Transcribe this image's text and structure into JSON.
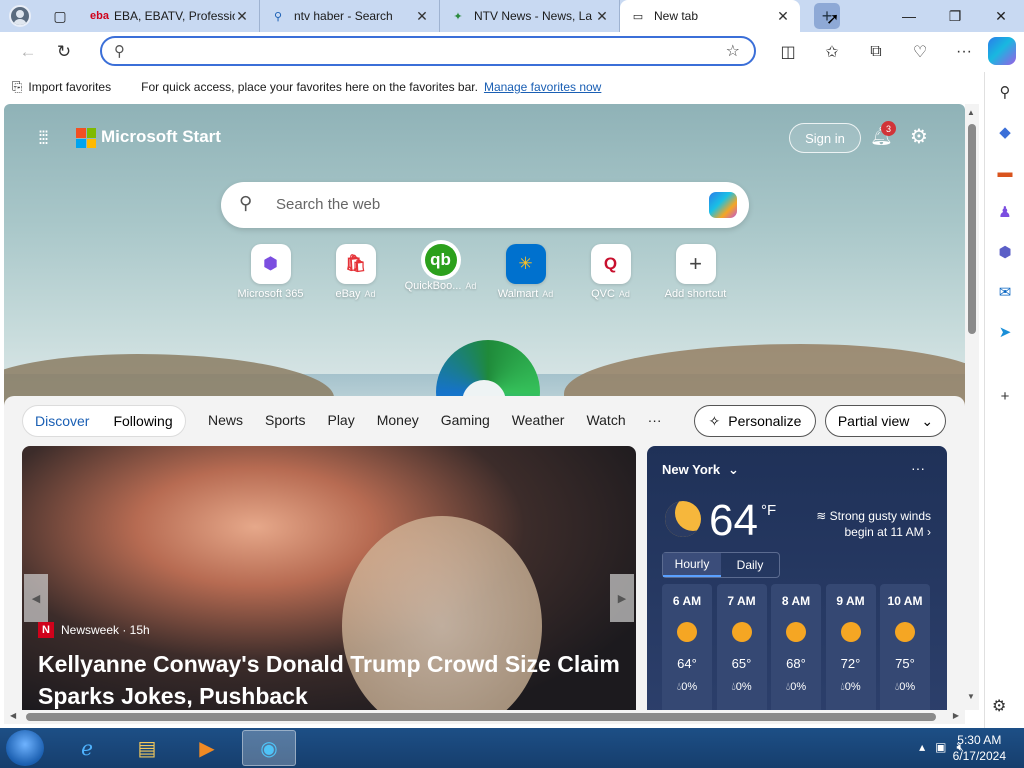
{
  "tabs": [
    {
      "favicon": "ebatv",
      "title": "EBA, EBATV, Professio",
      "color": "#d0021b"
    },
    {
      "favicon": "search-icon",
      "title": "ntv haber - Search",
      "color": "#1a5fb4"
    },
    {
      "favicon": "ntv",
      "title": "NTV News - News, La",
      "color": "#2b8a3e"
    },
    {
      "favicon": "newtab-icon",
      "title": "New tab",
      "color": "#333"
    }
  ],
  "favorites_bar": {
    "import_label": "Import favorites",
    "message": "For quick access, place your favorites here on the favorites bar.",
    "manage_link": "Manage favorites now"
  },
  "start": {
    "title": "Microsoft Start",
    "sign_in": "Sign in",
    "notif_count": "3",
    "search_placeholder": "Search the web"
  },
  "shortcuts": [
    {
      "label": "Microsoft 365",
      "ad": "",
      "icon": "M",
      "color": "#7b4ee0"
    },
    {
      "label": "eBay",
      "ad": "Ad",
      "icon": "e",
      "color": "#e53238"
    },
    {
      "label": "QuickBoo...",
      "ad": "Ad",
      "icon": "qb",
      "color": "#2ca01c"
    },
    {
      "label": "Walmart",
      "ad": "Ad",
      "icon": "✳",
      "color": "#0071ce"
    },
    {
      "label": "QVC",
      "ad": "Ad",
      "icon": "Q",
      "color": "#c8102e"
    },
    {
      "label": "Add shortcut",
      "ad": "",
      "icon": "+",
      "color": "#444"
    }
  ],
  "feed_nav": {
    "discover": "Discover",
    "following": "Following",
    "links": [
      "News",
      "Sports",
      "Play",
      "Money",
      "Gaming",
      "Weather",
      "Watch",
      "···"
    ],
    "personalize": "Personalize",
    "partial_view": "Partial view"
  },
  "hero": {
    "source": "Newsweek · 15h",
    "headline": "Kellyanne Conway's Donald Trump Crowd Size Claim Sparks Jokes, Pushback"
  },
  "weather": {
    "city": "New York",
    "temp": "64",
    "unit": "°F",
    "alert": "Strong gusty winds begin at 11 AM",
    "tab_hourly": "Hourly",
    "tab_daily": "Daily",
    "hours": [
      {
        "time": "6 AM",
        "temp": "64°",
        "precip": "0%"
      },
      {
        "time": "7 AM",
        "temp": "65°",
        "precip": "0%"
      },
      {
        "time": "8 AM",
        "temp": "68°",
        "precip": "0%"
      },
      {
        "time": "9 AM",
        "temp": "72°",
        "precip": "0%"
      },
      {
        "time": "10 AM",
        "temp": "75°",
        "precip": "0%"
      }
    ]
  },
  "taskbar": {
    "time": "5:30 AM",
    "date": "6/17/2024"
  }
}
